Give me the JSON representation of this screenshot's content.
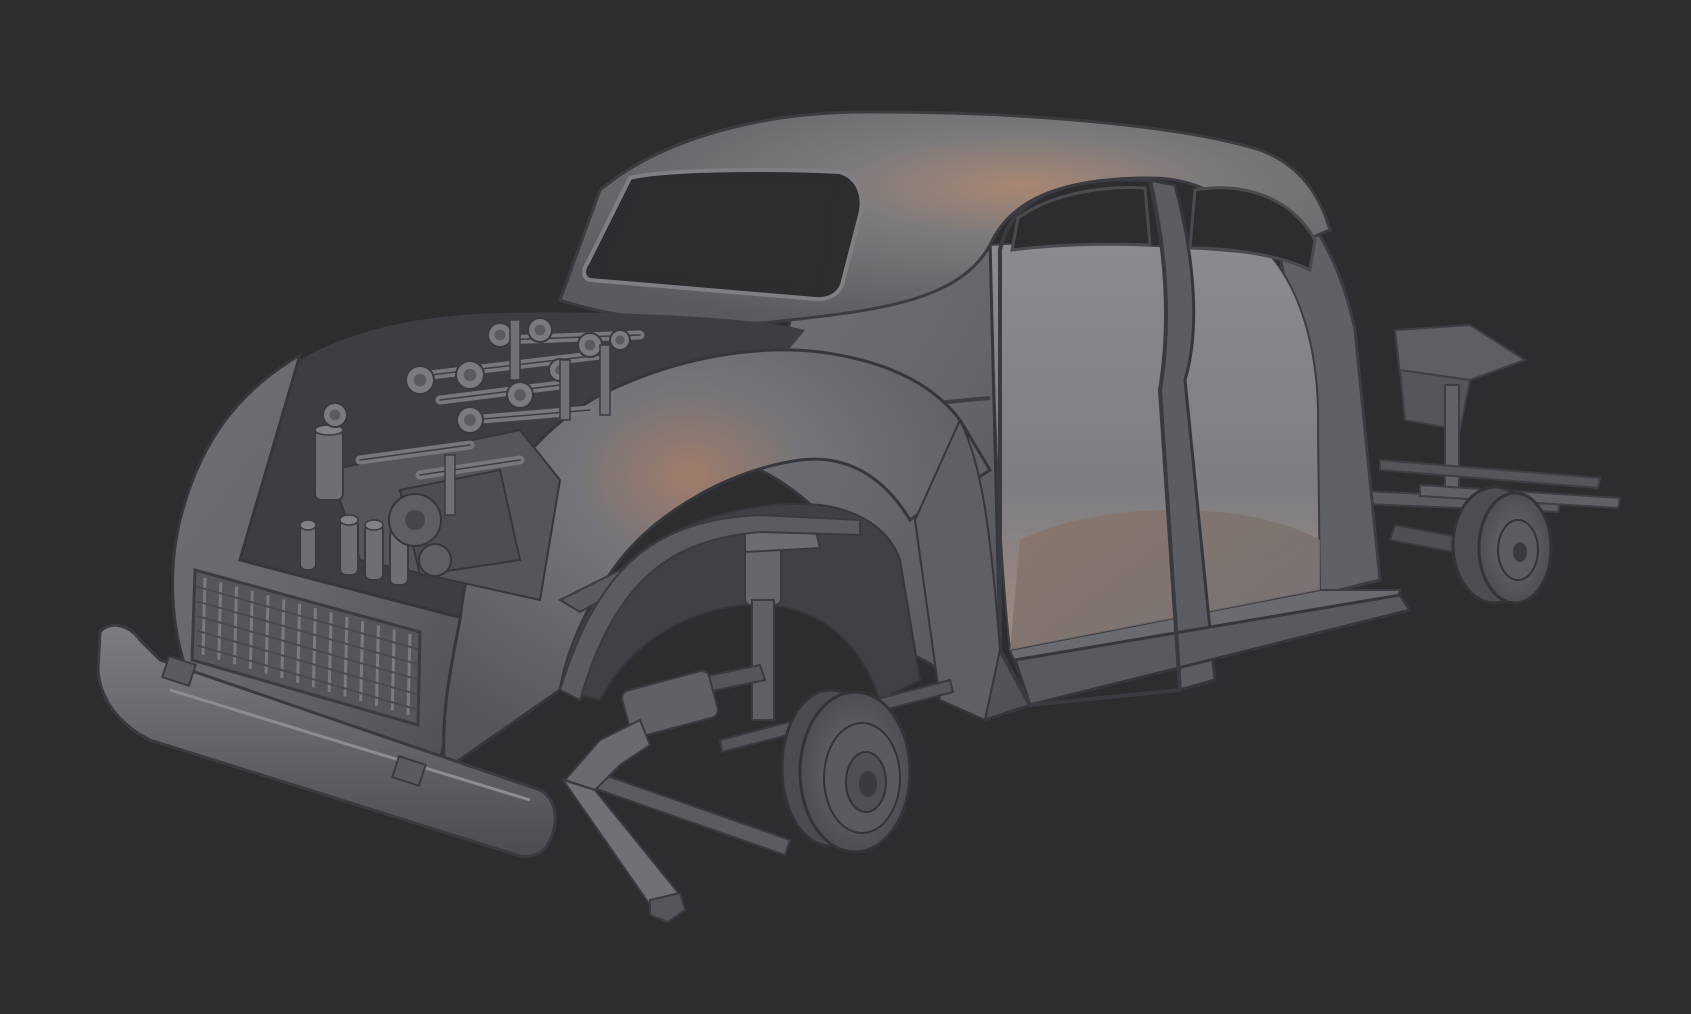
{
  "scene": {
    "subject": "3d-render-car-body",
    "background_color": "#2d2d2f",
    "body_color": "#6e6f74",
    "body_dark": "#4a4b50",
    "body_light": "#9a9aa0",
    "highlight_color": "#b89078",
    "interior_color": "#8c8d93"
  }
}
